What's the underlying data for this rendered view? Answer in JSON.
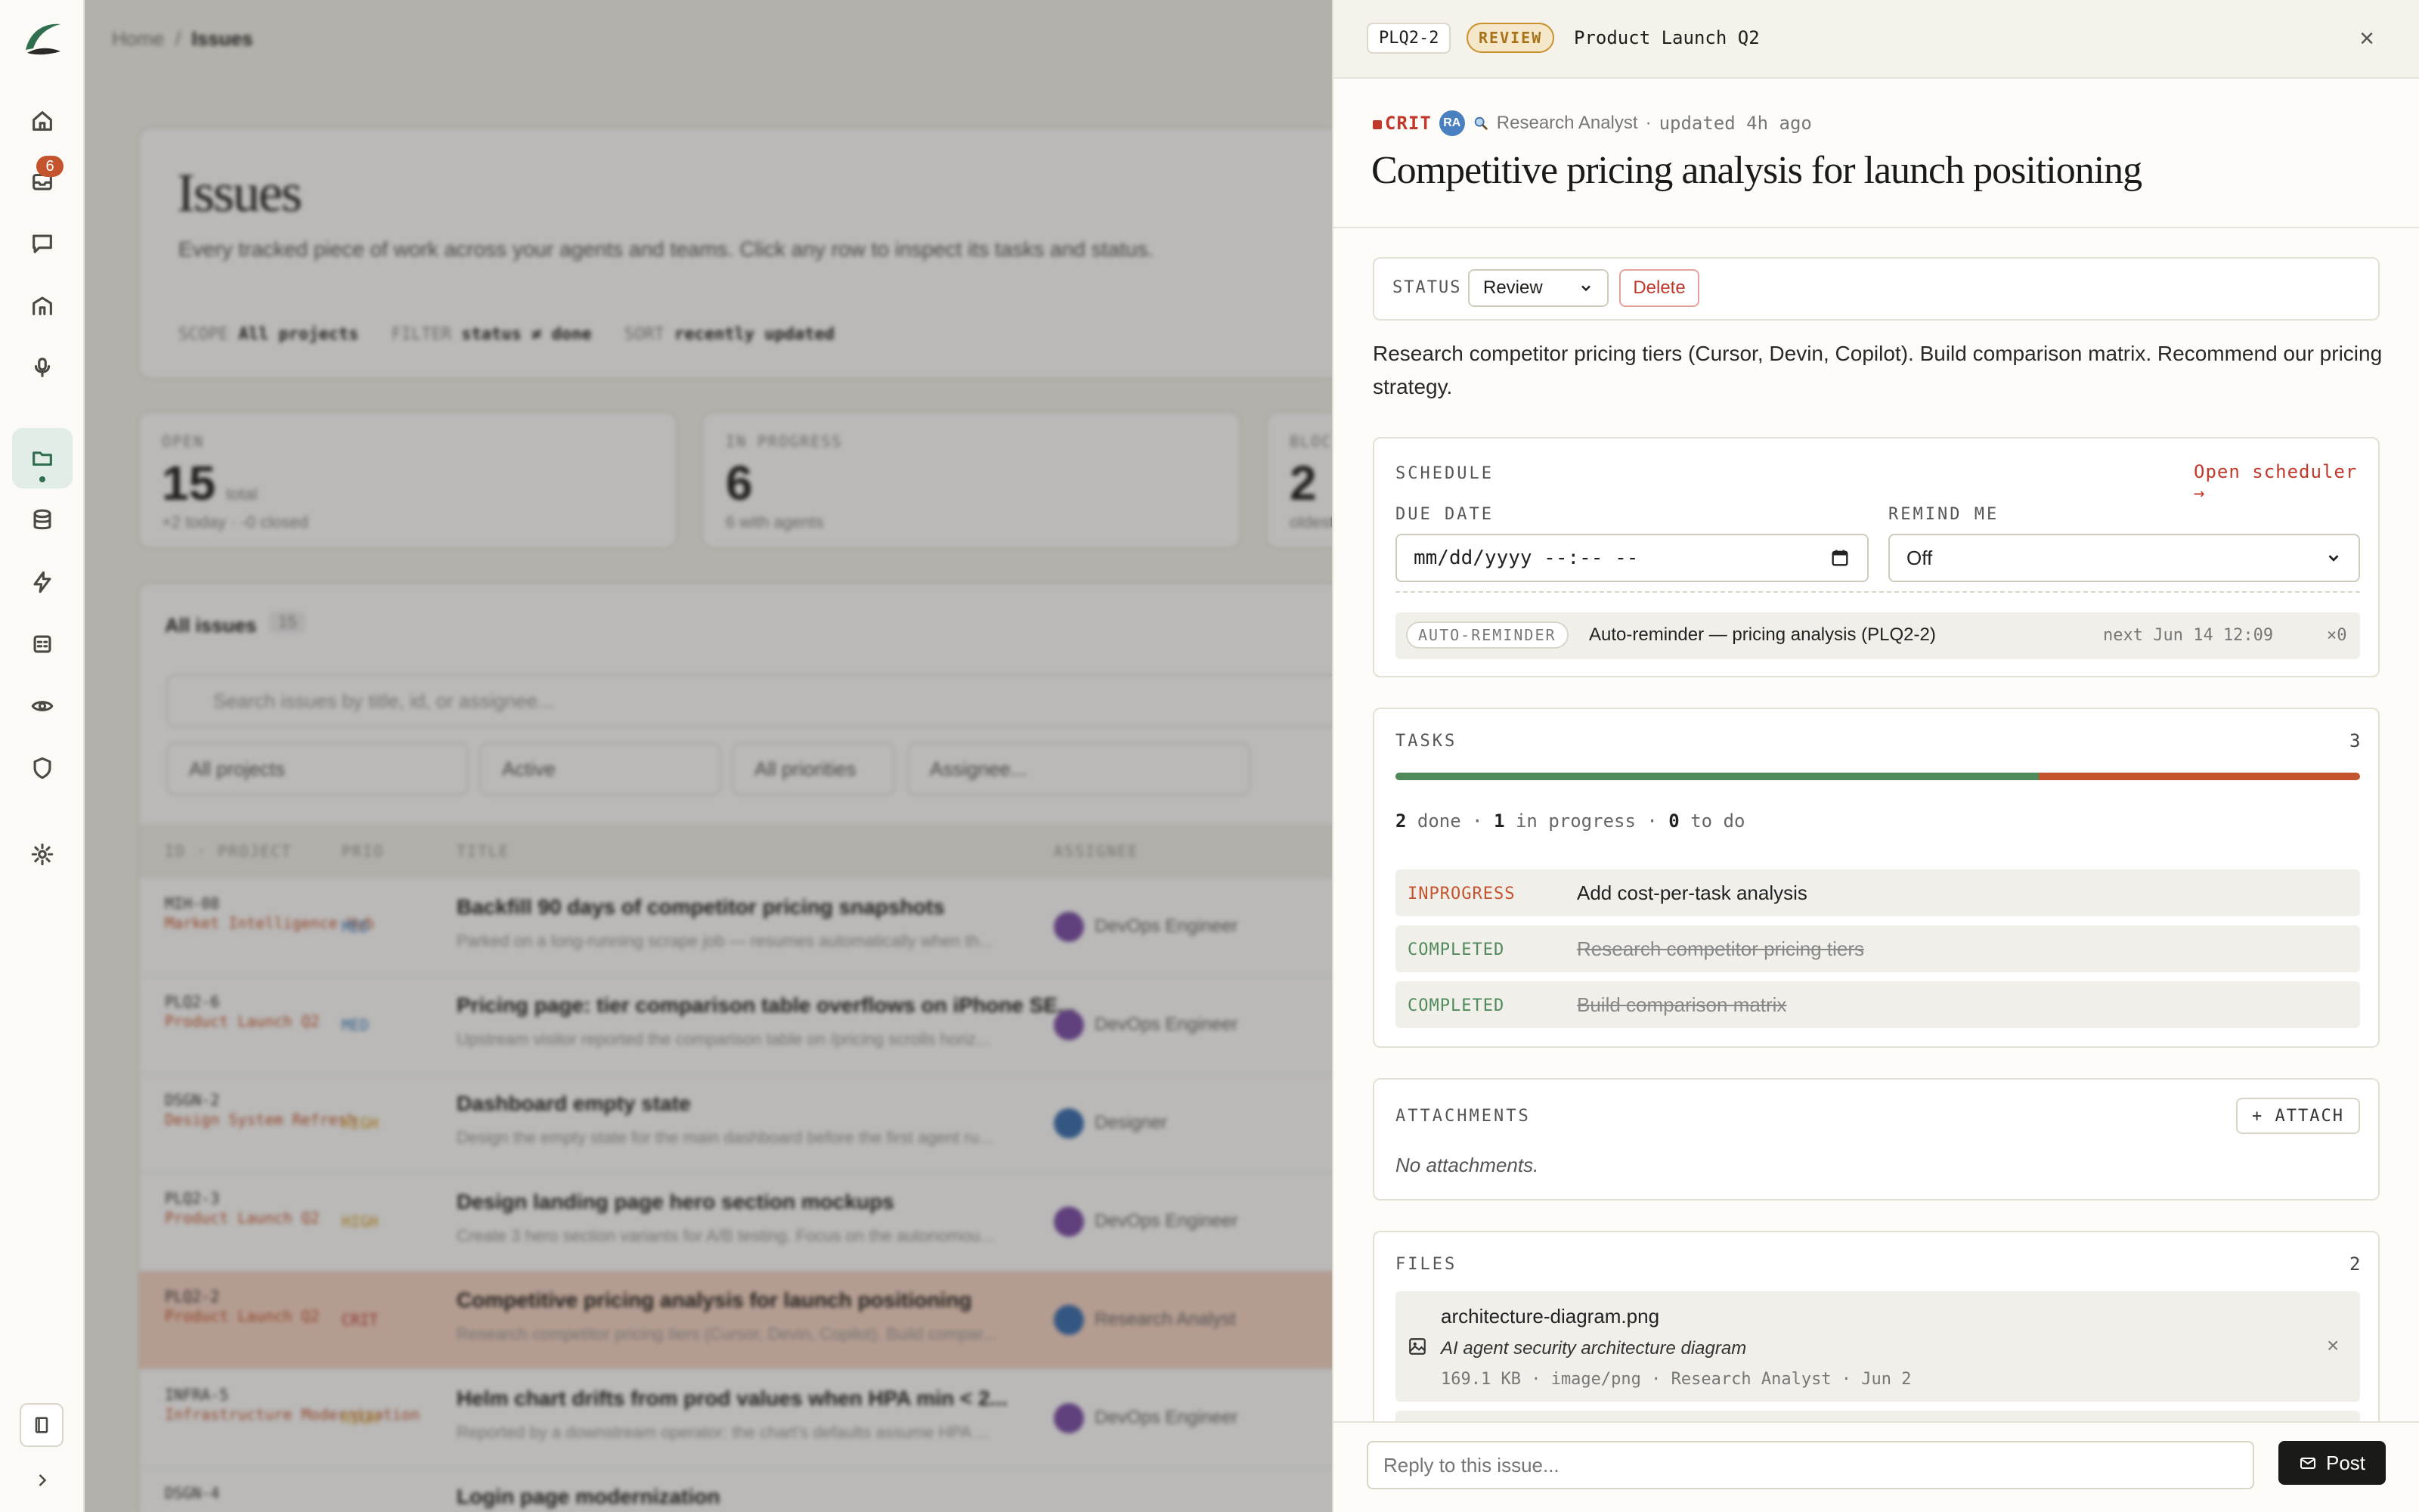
{
  "rail": {
    "inbox_badge": "6"
  },
  "background": {
    "breadcrumb": {
      "home": "Home",
      "sep": "/",
      "current": "Issues"
    },
    "title": "Issues",
    "subtitle": "Every tracked piece of work across your agents and teams. Click any row to inspect its tasks and status.",
    "meta": [
      {
        "label": "SCOPE",
        "value": "All projects"
      },
      {
        "label": "FILTER",
        "value": "status ≠ done"
      },
      {
        "label": "SORT",
        "value": "recently updated"
      }
    ],
    "stats": [
      {
        "label": "OPEN",
        "value": "15",
        "unit": "total",
        "sub": "+2 today · -0 closed"
      },
      {
        "label": "IN PROGRESS",
        "value": "6",
        "unit": "",
        "sub": "6 with agents"
      },
      {
        "label": "BLOCKED",
        "value": "2",
        "unit": "",
        "sub": "oldest"
      }
    ],
    "list_title": "All issues",
    "list_count": "15",
    "search_placeholder": "Search issues by title, id, or assignee...",
    "filters": [
      "All projects",
      "Active",
      "All priorities",
      "Assignee..."
    ],
    "columns": [
      "ID · PROJECT",
      "PRIO",
      "TITLE",
      "ASSIGNEE"
    ],
    "rows": [
      {
        "id": "MIH-08",
        "project": "Market Intelligence Hub",
        "prio": "MED",
        "title": "Backfill 90 days of competitor pricing snapshots",
        "desc": "Parked on a long-running scrape job — resumes automatically when th...",
        "assignee": "DevOps Engineer"
      },
      {
        "id": "PLQ2-6",
        "project": "Product Launch Q2",
        "prio": "MED",
        "title": "Pricing page: tier comparison table overflows on iPhone SE...",
        "desc": "Upstream visitor reported the comparison table on /pricing scrolls horiz...",
        "assignee": "DevOps Engineer"
      },
      {
        "id": "DSGN-2",
        "project": "Design System Refresh",
        "prio": "HIGH",
        "title": "Dashboard empty state",
        "desc": "Design the empty state for the main dashboard before the first agent ru...",
        "assignee": "Designer"
      },
      {
        "id": "PLQ2-3",
        "project": "Product Launch Q2",
        "prio": "HIGH",
        "title": "Design landing page hero section mockups",
        "desc": "Create 3 hero section variants for A/B testing. Focus on the autonomou...",
        "assignee": "DevOps Engineer"
      },
      {
        "id": "PLQ2-2",
        "project": "Product Launch Q2",
        "prio": "CRIT",
        "title": "Competitive pricing analysis for launch positioning",
        "desc": "Research competitor pricing tiers (Cursor, Devin, Copilot). Build compar...",
        "assignee": "Research Analyst"
      },
      {
        "id": "INFRA-5",
        "project": "Infrastructure Modernization",
        "prio": "HIGH",
        "title": "Helm chart drifts from prod values when HPA min < 2...",
        "desc": "Reported by a downstream operator: the chart's defaults assume HPA ...",
        "assignee": "DevOps Engineer"
      },
      {
        "id": "DSGN-4",
        "project": "",
        "prio": "",
        "title": "Login page modernization",
        "desc": "",
        "assignee": ""
      }
    ]
  },
  "panel": {
    "issue_id": "PLQ2-2",
    "status_chip": "REVIEW",
    "project": "Product Launch Q2",
    "priority": "CRIT",
    "assignee_initials": "RA",
    "assignee": "Research Analyst",
    "updated": "updated 4h ago",
    "dot": "·",
    "title": "Competitive pricing analysis for launch positioning",
    "status_label": "STATUS",
    "status_value": "Review",
    "delete_label": "Delete",
    "description": "Research competitor pricing tiers (Cursor, Devin, Copilot). Build comparison matrix. Recommend our pricing strategy.",
    "schedule": {
      "label": "SCHEDULE",
      "open_link": "Open scheduler →",
      "due_label": "DUE DATE",
      "due_value": "mm/dd/yyyy --:-- --",
      "remind_label": "REMIND ME",
      "remind_value": "Off",
      "reminder_chip": "AUTO-REMINDER",
      "reminder_text": "Auto-reminder — pricing analysis (PLQ2-2)",
      "reminder_next": "next Jun 14 12:09",
      "reminder_count": "×0"
    },
    "tasks": {
      "label": "TASKS",
      "count": "3",
      "done_fraction": 0.667,
      "done": "2",
      "done_label": "done",
      "in_progress": "1",
      "in_progress_label": "in progress",
      "todo": "0",
      "todo_label": "to do",
      "items": [
        {
          "status": "INPROGRESS",
          "name": "Add cost-per-task analysis"
        },
        {
          "status": "COMPLETED",
          "name": "Research competitor pricing tiers"
        },
        {
          "status": "COMPLETED",
          "name": "Build comparison matrix"
        }
      ]
    },
    "attachments": {
      "label": "ATTACHMENTS",
      "button": "+ ATTACH",
      "empty": "No attachments."
    },
    "files": {
      "label": "FILES",
      "count": "2",
      "items": [
        {
          "name": "architecture-diagram.png",
          "desc": "AI agent security architecture diagram",
          "meta": "169.1 KB · image/png · Research Analyst · Jun 2"
        }
      ]
    },
    "reply_placeholder": "Reply to this issue...",
    "post_label": "Post"
  },
  "colors": {
    "accent_green": "#2f6e4f",
    "crit_red": "#c0392b",
    "review_amber": "#c9912b",
    "progress_orange": "#c4542e"
  }
}
